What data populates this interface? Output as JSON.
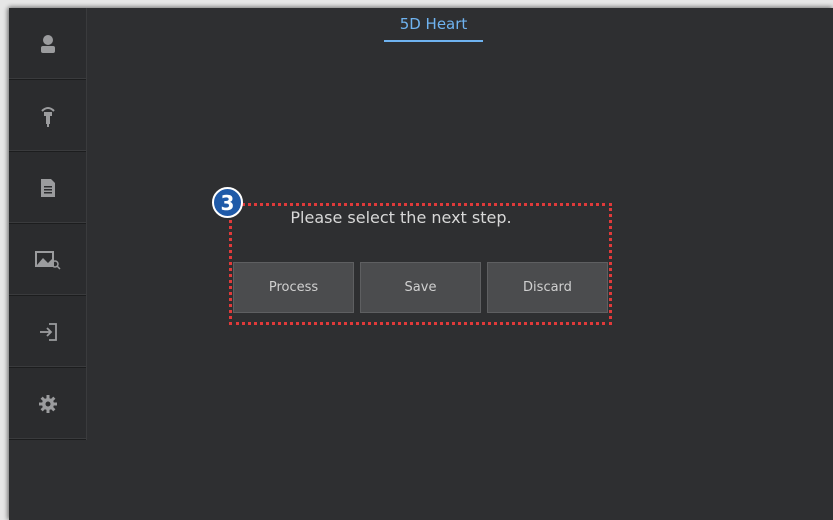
{
  "header": {
    "tab_title": "5D Heart"
  },
  "sidebar": {
    "items": [
      {
        "name": "patient",
        "icon": "person-icon"
      },
      {
        "name": "probe",
        "icon": "probe-icon"
      },
      {
        "name": "report",
        "icon": "document-icon"
      },
      {
        "name": "review",
        "icon": "image-search-icon"
      },
      {
        "name": "exit",
        "icon": "exit-icon"
      },
      {
        "name": "settings",
        "icon": "gear-icon"
      }
    ]
  },
  "dialog": {
    "prompt": "Please select the next step.",
    "buttons": {
      "process": "Process",
      "save": "Save",
      "discard": "Discard"
    }
  },
  "annotation": {
    "step_number": "3",
    "color": "#e03a3a",
    "badge_color": "#1f5aa8"
  },
  "colors": {
    "accent": "#6fb3f0",
    "background": "#2e2f31"
  }
}
